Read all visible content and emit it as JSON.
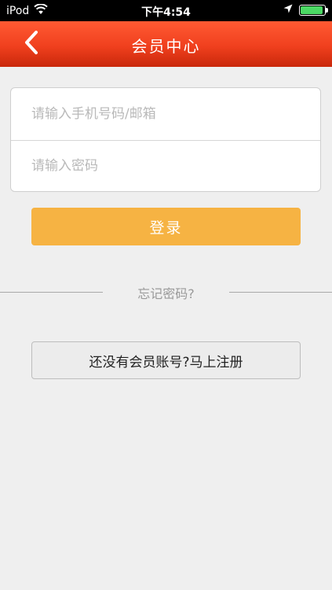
{
  "status_bar": {
    "carrier": "iPod",
    "time": "下午4:54",
    "battery_level": 0.92,
    "icons": [
      "wifi-icon",
      "location-arrow-icon",
      "battery-icon"
    ]
  },
  "nav": {
    "title": "会员中心",
    "back_icon": "chevron-left-icon"
  },
  "form": {
    "account_placeholder": "请输入手机号码/邮箱",
    "account_value": "",
    "password_placeholder": "请输入密码",
    "password_value": ""
  },
  "login_label": "登录",
  "forgot_label": "忘记密码?",
  "register_label": "还没有会员账号?马上注册",
  "colors": {
    "nav_red": "#f0401e",
    "login_orange": "#f6b343",
    "background": "#efefef"
  }
}
